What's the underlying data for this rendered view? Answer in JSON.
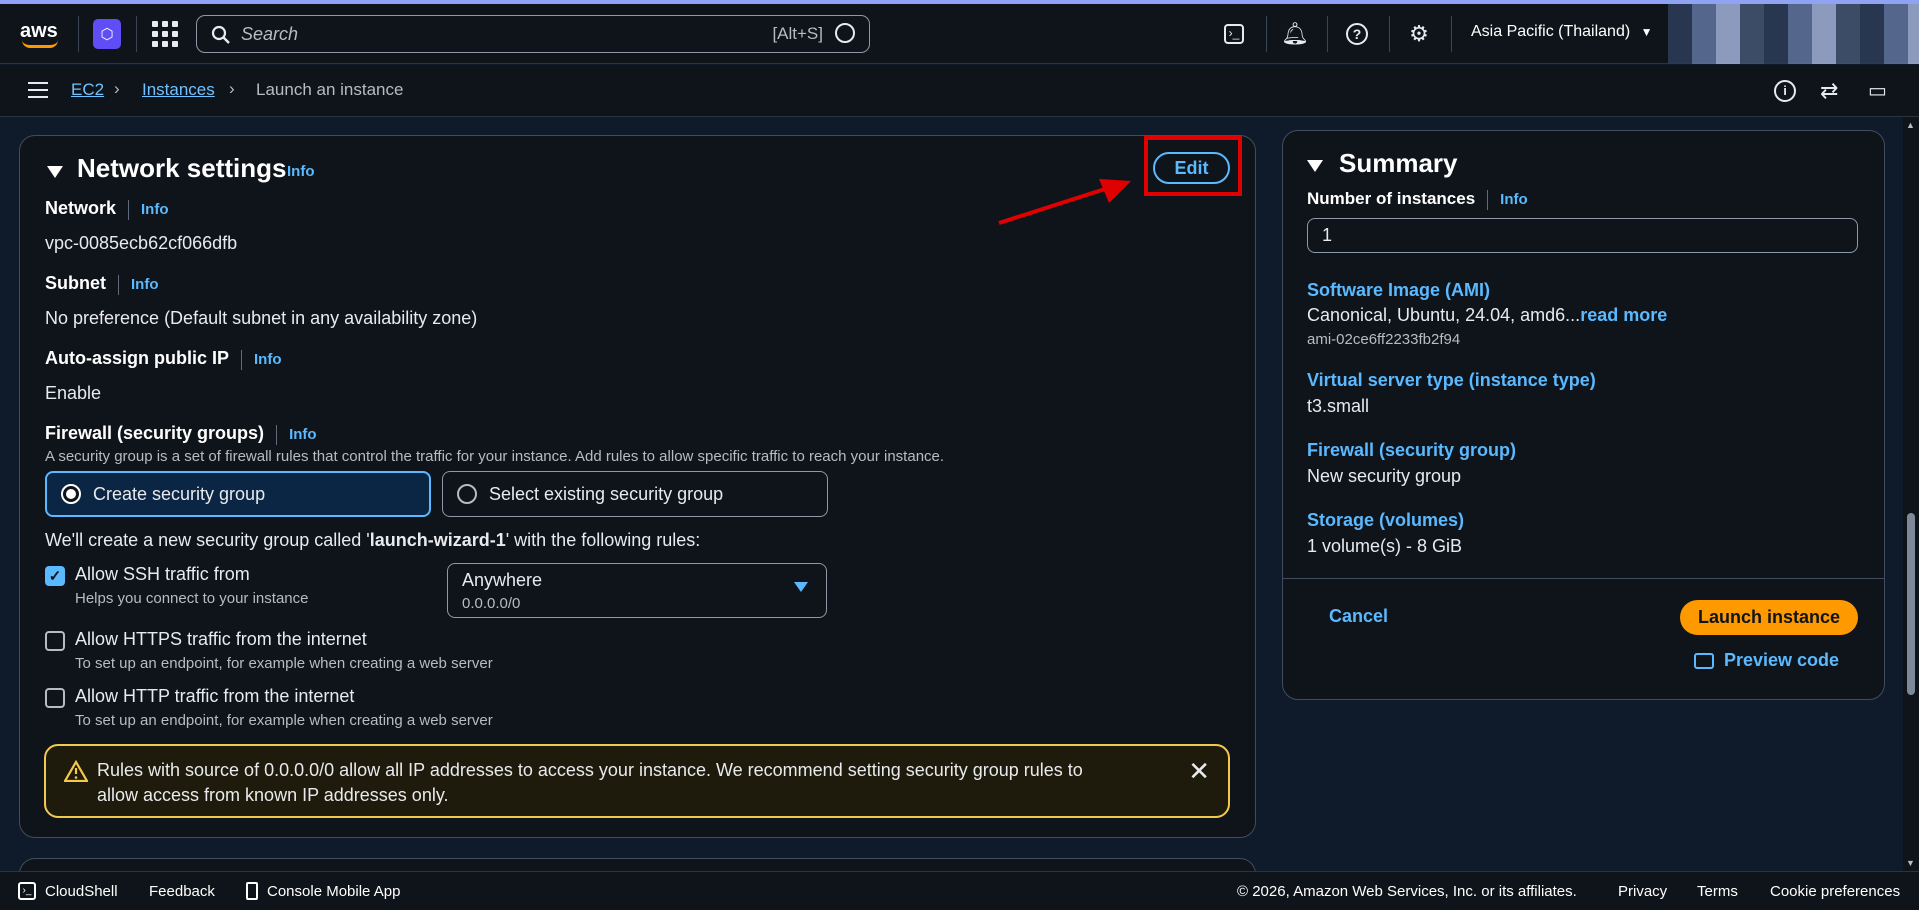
{
  "topnav": {
    "search_placeholder": "Search",
    "search_shortcut": "[Alt+S]",
    "region": "Asia Pacific (Thailand)"
  },
  "breadcrumb": {
    "ec2": "EC2",
    "instances": "Instances",
    "current": "Launch an instance"
  },
  "network": {
    "title": "Network settings",
    "info": "Info",
    "edit_label": "Edit",
    "network_label": "Network",
    "network_value": "vpc-0085ecb62cf066dfb",
    "subnet_label": "Subnet",
    "subnet_value": "No preference (Default subnet in any availability zone)",
    "public_ip_label": "Auto-assign public IP",
    "public_ip_value": "Enable",
    "firewall_label": "Firewall (security groups)",
    "firewall_desc": "A security group is a set of firewall rules that control the traffic for your instance. Add rules to allow specific traffic to reach your instance.",
    "create_sg": "Create security group",
    "select_sg": "Select existing security group",
    "new_sg_prefix": "We'll create a new security group called '",
    "new_sg_name": "launch-wizard-1",
    "new_sg_suffix": "' with the following rules:",
    "ssh_label": "Allow SSH traffic from",
    "ssh_help": "Helps you connect to your instance",
    "ssh_source": "Anywhere",
    "ssh_cidr": "0.0.0.0/0",
    "https_label": "Allow HTTPS traffic from the internet",
    "https_help": "To set up an endpoint, for example when creating a web server",
    "http_label": "Allow HTTP traffic from the internet",
    "http_help": "To set up an endpoint, for example when creating a web server",
    "warning": "Rules with source of 0.0.0.0/0 allow all IP addresses to access your instance. We recommend setting security group rules to allow access from known IP addresses only."
  },
  "summary": {
    "title": "Summary",
    "instances_label": "Number of instances",
    "info": "Info",
    "instances_value": "1",
    "ami_label": "Software Image (AMI)",
    "ami_value": "Canonical, Ubuntu, 24.04, amd6...",
    "read_more": "read more",
    "ami_id": "ami-02ce6ff2233fb2f94",
    "type_label": "Virtual server type (instance type)",
    "type_value": "t3.small",
    "fw_label": "Firewall (security group)",
    "fw_value": "New security group",
    "storage_label": "Storage (volumes)",
    "storage_value": "1 volume(s) - 8 GiB",
    "cancel": "Cancel",
    "launch": "Launch instance",
    "preview": "Preview code"
  },
  "footer": {
    "cloudshell": "CloudShell",
    "feedback": "Feedback",
    "mobile": "Console Mobile App",
    "copyright": "© 2026, Amazon Web Services, Inc. or its affiliates.",
    "privacy": "Privacy",
    "terms": "Terms",
    "cookies": "Cookie preferences"
  },
  "colors": {
    "accent": "#5ab9ff",
    "launch": "#ff9900",
    "annotation": "#e00000",
    "warning": "#f2c94c"
  }
}
